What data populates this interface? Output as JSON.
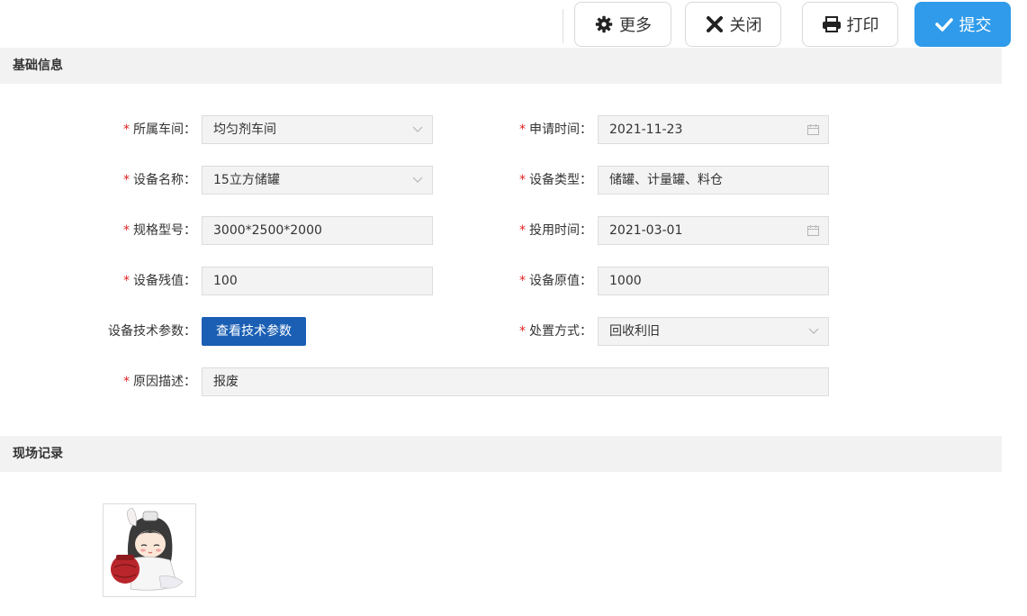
{
  "toolbar": {
    "more_label": "更多",
    "close_label": "关闭",
    "print_label": "打印",
    "submit_label": "提交"
  },
  "sections": {
    "basic": "基础信息",
    "site": "现场记录"
  },
  "form": {
    "workshop": {
      "label": "所属车间：",
      "required": "*",
      "value": "均匀剂车间",
      "icon": "chevron-down-icon"
    },
    "apply_time": {
      "label": "申请时间：",
      "required": "*",
      "value": "2021-11-23",
      "icon": "calendar-icon"
    },
    "equipment_name": {
      "label": "设备名称：",
      "required": "*",
      "value": "15立方储罐",
      "icon": "chevron-down-icon"
    },
    "equipment_type": {
      "label": "设备类型：",
      "required": "*",
      "value": "储罐、计量罐、料仓"
    },
    "spec_model": {
      "label": "规格型号：",
      "required": "*",
      "value": "3000*2500*2000"
    },
    "use_time": {
      "label": "投用时间：",
      "required": "*",
      "value": "2021-03-01",
      "icon": "calendar-icon"
    },
    "residual_value": {
      "label": "设备残值：",
      "required": "*",
      "value": "100"
    },
    "original_value": {
      "label": "设备原值：",
      "required": "*",
      "value": "1000"
    },
    "tech_params": {
      "label": "设备技术参数：",
      "button": "查看技术参数"
    },
    "disposal": {
      "label": "处置方式：",
      "required": "*",
      "value": "回收利旧",
      "icon": "chevron-down-icon"
    },
    "reason": {
      "label": "原因描述：",
      "required": "*",
      "value": "报废"
    }
  },
  "colors": {
    "primary_button": "#2f9bea",
    "tech_button": "#1a5fb4",
    "required_mark": "#e02020",
    "section_bg": "#f2f2f2"
  }
}
